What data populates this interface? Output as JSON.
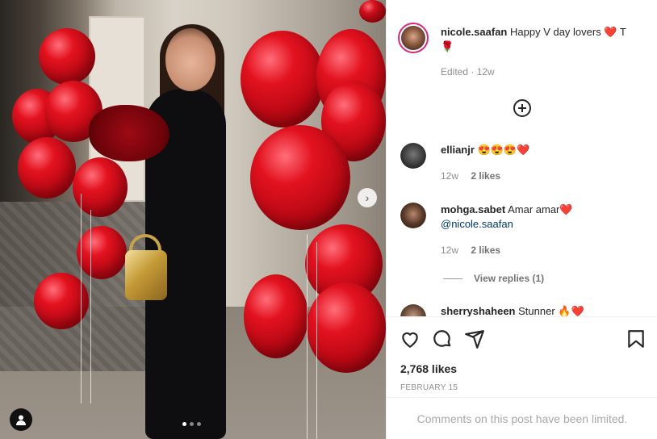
{
  "post": {
    "author": "nicole.saafan",
    "caption": "Happy V day lovers ❤️ T\n🌹",
    "edited_label": "Edited",
    "time_ago": "12w",
    "carousel": {
      "current": 1,
      "total": 3
    }
  },
  "comments": [
    {
      "username": "ellianjr",
      "text": "😍😍😍❤️",
      "time_ago": "12w",
      "likes": "2 likes"
    },
    {
      "username": "mohga.sabet",
      "text": "Amar amar❤️",
      "mention": "@nicole.saafan",
      "time_ago": "12w",
      "likes": "2 likes",
      "view_replies": "View replies (1)"
    },
    {
      "username": "sherryshaheen",
      "text": "Stunner 🔥❤️"
    }
  ],
  "stats": {
    "likes": "2,768 likes",
    "date": "FEBRUARY 15"
  },
  "footer": {
    "comments_limited": "Comments on this post have been limited."
  },
  "icons": [
    "next-arrow-icon",
    "user-tag-icon",
    "add-circle-icon",
    "heart-icon",
    "comment-icon",
    "share-icon",
    "bookmark-icon"
  ],
  "colors": {
    "accent_ring": "#d62976",
    "balloon_red": "#e3121f",
    "muted_text": "#8e8e8e"
  }
}
